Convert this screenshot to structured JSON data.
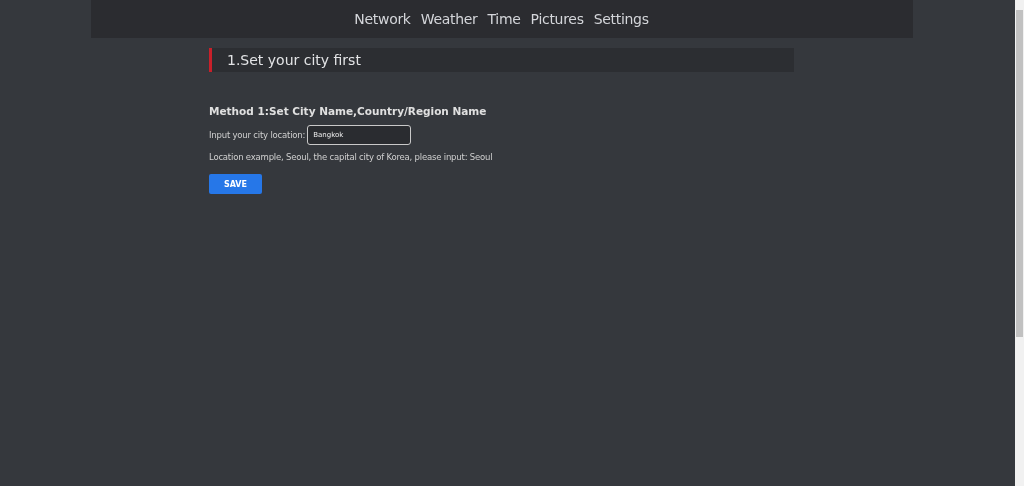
{
  "nav": {
    "items": [
      "Network",
      "Weather",
      "Time",
      "Pictures",
      "Settings"
    ]
  },
  "section": {
    "title": "1.Set your city first"
  },
  "method": {
    "heading": "Method 1:Set City Name,Country/Region Name",
    "label": "Input your city location:",
    "value": "Bangkok",
    "example": "Location example, Seoul, the capital city of Korea, please input: Seoul",
    "button": "SAVE"
  }
}
